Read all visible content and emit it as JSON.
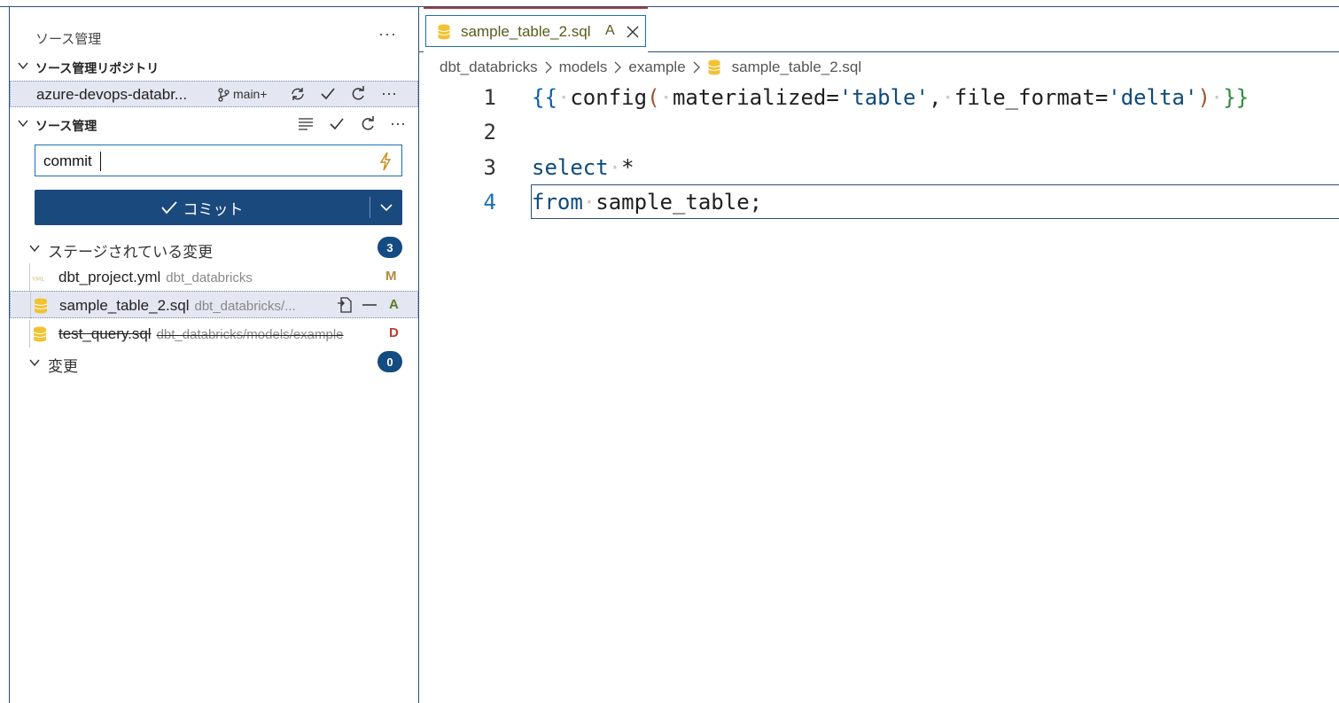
{
  "sidebar": {
    "title": "ソース管理",
    "more": "···",
    "repos_header": "ソース管理リポジトリ",
    "repo": {
      "name": "azure-devops-databr...",
      "branch": "main+"
    },
    "sc_header": "ソース管理",
    "commit_input": {
      "value": "commit"
    },
    "commit_button": "コミット",
    "staged": {
      "label": "ステージされている変更",
      "count": "3",
      "files": [
        {
          "name": "dbt_project.yml",
          "dir": "dbt_databricks",
          "status": "M",
          "icon": "yaml-file-icon"
        },
        {
          "name": "sample_table_2.sql",
          "dir": "dbt_databricks/...",
          "status": "A",
          "icon": "database-file-icon"
        },
        {
          "name": "test_query.sql",
          "dir": "dbt_databricks/models/example",
          "status": "D",
          "icon": "database-file-icon"
        }
      ]
    },
    "changes": {
      "label": "変更",
      "count": "0"
    }
  },
  "editor": {
    "tab": {
      "name": "sample_table_2.sql",
      "status": "A"
    },
    "breadcrumb": [
      "dbt_databricks",
      "models",
      "example",
      "sample_table_2.sql"
    ],
    "line_numbers": [
      "1",
      "2",
      "3",
      "4"
    ],
    "code": {
      "line1": {
        "open": "{{",
        "fn": "config",
        "arg1_key": "materialized",
        "arg1_val": "'table'",
        "arg2_key": "file_format",
        "arg2_val": "'delta'",
        "close": "}}"
      },
      "line3": {
        "kw": "select",
        "rest": "*"
      },
      "line4": {
        "kw": "from",
        "rest": "sample_table;"
      }
    }
  },
  "colors": {
    "accent": "#1a497e",
    "border": "#2b4f75",
    "added": "#5a7a2a",
    "modified": "#b08a3a",
    "deleted": "#c0392b"
  }
}
